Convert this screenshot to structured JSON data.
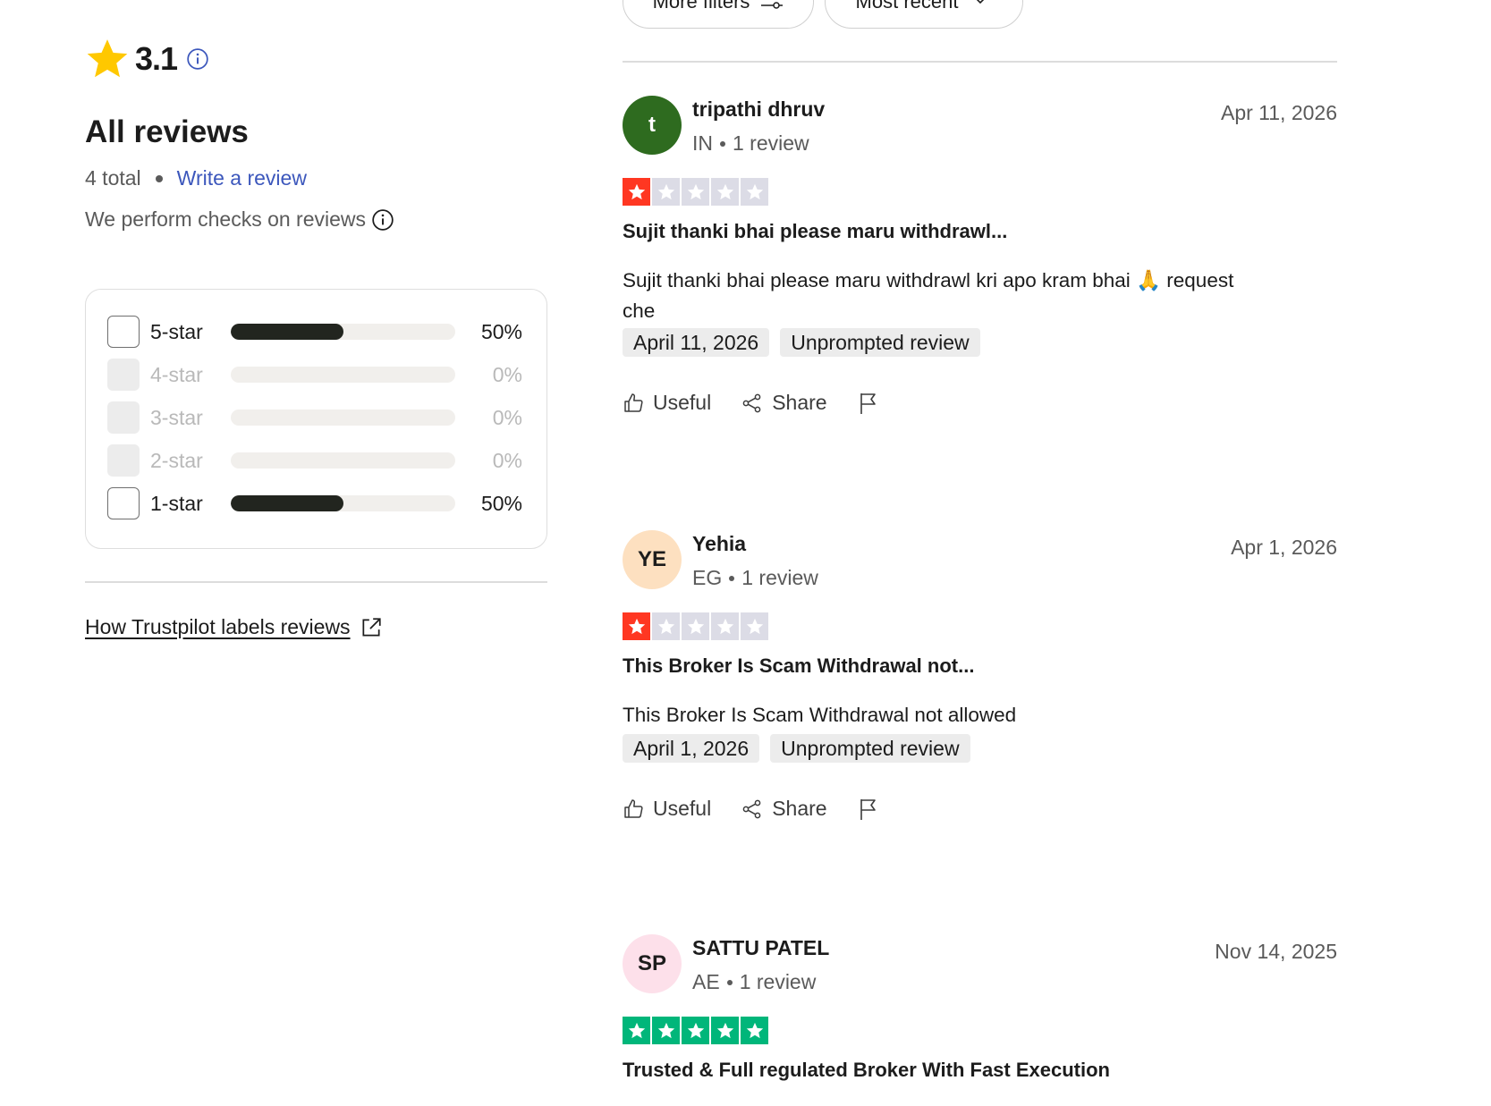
{
  "summary": {
    "rating": "3.1",
    "heading": "All reviews",
    "total_text": "4 total",
    "write_review": "Write a review",
    "checks_text": "We perform checks on reviews",
    "labels_link": "How Trustpilot labels reviews"
  },
  "colors": {
    "star_yellow": "#ffc800",
    "red_star": "#ff3722",
    "green_star": "#00b67a",
    "empty_star": "#dcdce6",
    "link_blue": "#3c57bc",
    "bar_fill": "#22251f"
  },
  "rating_filters": [
    {
      "label": "5-star",
      "percent": "50%",
      "fill": 0.5,
      "enabled": true
    },
    {
      "label": "4-star",
      "percent": "0%",
      "fill": 0,
      "enabled": false
    },
    {
      "label": "3-star",
      "percent": "0%",
      "fill": 0,
      "enabled": false
    },
    {
      "label": "2-star",
      "percent": "0%",
      "fill": 0,
      "enabled": false
    },
    {
      "label": "1-star",
      "percent": "50%",
      "fill": 0.5,
      "enabled": true
    }
  ],
  "toolbar": {
    "more_filters": "More filters",
    "sort": "Most recent"
  },
  "reviews": [
    {
      "initials": "t",
      "avatar_bg": "#2e6b1f",
      "avatar_fg": "#ffffff",
      "name": "tripathi dhruv",
      "country": "IN",
      "review_count": "1 review",
      "date": "Apr 11, 2026",
      "stars": 1,
      "title": "Sujit thanki bhai please maru withdrawl...",
      "body": "Sujit thanki bhai please maru withdrawl kri apo kram bhai 🙏 request che",
      "experience_date": "April 11, 2026",
      "tag": "Unprompted review",
      "useful": "Useful",
      "share": "Share"
    },
    {
      "initials": "YE",
      "avatar_bg": "#fde0c0",
      "avatar_fg": "#1c1c1c",
      "name": "Yehia",
      "country": "EG",
      "review_count": "1 review",
      "date": "Apr 1, 2026",
      "stars": 1,
      "title": "This Broker Is Scam Withdrawal not...",
      "body": "This Broker Is Scam Withdrawal not allowed",
      "experience_date": "April 1, 2026",
      "tag": "Unprompted review",
      "useful": "Useful",
      "share": "Share"
    },
    {
      "initials": "SP",
      "avatar_bg": "#fde0ea",
      "avatar_fg": "#1c1c1c",
      "name": "SATTU PATEL",
      "country": "AE",
      "review_count": "1 review",
      "date": "Nov 14, 2025",
      "stars": 5,
      "title": "Trusted & Full regulated Broker With Fast Execution"
    }
  ]
}
